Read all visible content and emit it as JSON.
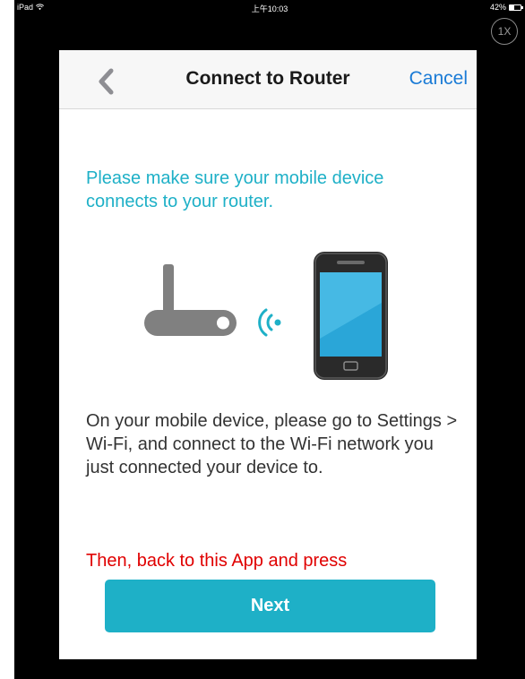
{
  "status_bar": {
    "device": "iPad",
    "time": "上午10:03",
    "battery": "42%",
    "battery_level": 0.42
  },
  "zoom_button": {
    "label": "1X"
  },
  "navbar": {
    "title": "Connect to Router",
    "cancel_label": "Cancel",
    "back_icon": "chevron-left-icon"
  },
  "content": {
    "instruction": "Please make sure your mobile device connects to your router.",
    "body": "On your mobile device, please go to Settings > Wi-Fi, and connect to the Wi-Fi network you just connected your device to.",
    "warning": "Then, back to this App and press",
    "next_label": "Next"
  },
  "illustration": {
    "router_icon": "router-icon",
    "signal_icon": "wifi-signal-icon",
    "phone_icon": "smartphone-icon"
  },
  "colors": {
    "accent": "#1eb0c7",
    "link": "#1a7bd6",
    "warning": "#e00000",
    "router_gray": "#808080"
  }
}
